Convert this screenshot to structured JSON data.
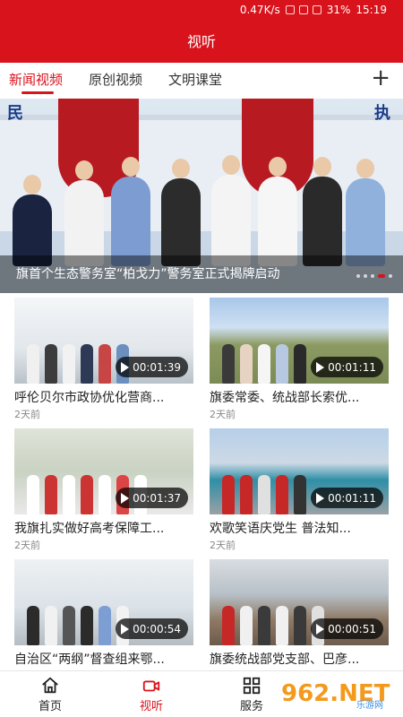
{
  "status_bar": {
    "net_speed": "0.47K/s",
    "battery": "31%",
    "time": "15:19"
  },
  "app_title": "视听",
  "tabs": [
    {
      "label": "新闻视频",
      "active": true
    },
    {
      "label": "原创视频",
      "active": false
    },
    {
      "label": "文明课堂",
      "active": false
    }
  ],
  "add_icon": "plus-icon",
  "banner": {
    "sign_left": "民",
    "sign_right": "执",
    "caption": "旗首个生态警务室“柏戈力”警务室正式揭牌启动",
    "slide_count": 5,
    "active_slide": 4
  },
  "videos": [
    {
      "title": "呼伦贝尔市政协优化营商...",
      "duration": "00:01:39",
      "date": "2天前"
    },
    {
      "title": "旗委常委、统战部长索优...",
      "duration": "00:01:11",
      "date": "2天前"
    },
    {
      "title": "我旗扎实做好高考保障工...",
      "duration": "00:01:37",
      "date": "2天前"
    },
    {
      "title": "欢歌笑语庆党生 普法知...",
      "duration": "00:01:11",
      "date": "2天前"
    },
    {
      "title": "自治区“两纲”督查组来鄂...",
      "duration": "00:00:54",
      "date": ""
    },
    {
      "title": "旗委统战部党支部、巴彦...",
      "duration": "00:00:51",
      "date": ""
    }
  ],
  "bottom_nav": [
    {
      "label": "首页",
      "icon": "home-icon",
      "active": false
    },
    {
      "label": "视听",
      "icon": "video-icon",
      "active": true
    },
    {
      "label": "服务",
      "icon": "grid-icon",
      "active": false
    }
  ],
  "watermark": {
    "text": "962.NET",
    "subtext": "乐游网"
  },
  "colors": {
    "primary": "#d9131c",
    "text": "#222222",
    "muted": "#888888"
  }
}
